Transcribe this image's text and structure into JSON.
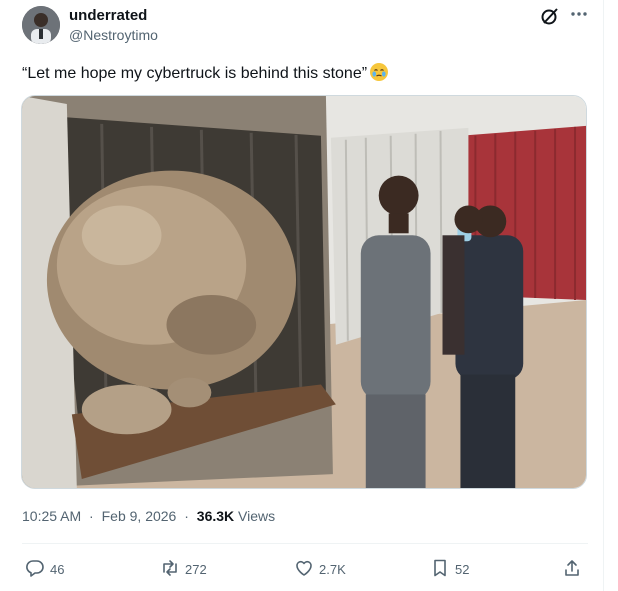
{
  "author": {
    "display_name": "underrated",
    "handle": "@Nestroytimo"
  },
  "tweet": {
    "text": "“Let me hope my cybertruck is behind this stone”",
    "emoji": "face-holding-back-tears"
  },
  "meta": {
    "time": "10:25 AM",
    "separator": "·",
    "date": "Feb 9, 2026",
    "views_count": "36.3K",
    "views_label": "Views"
  },
  "actions": {
    "replies": "46",
    "reposts": "272",
    "likes": "2.7K",
    "bookmarks": "52"
  },
  "colors": {
    "text_primary": "#0f1419",
    "text_secondary": "#536471",
    "border": "#eff3f4"
  }
}
